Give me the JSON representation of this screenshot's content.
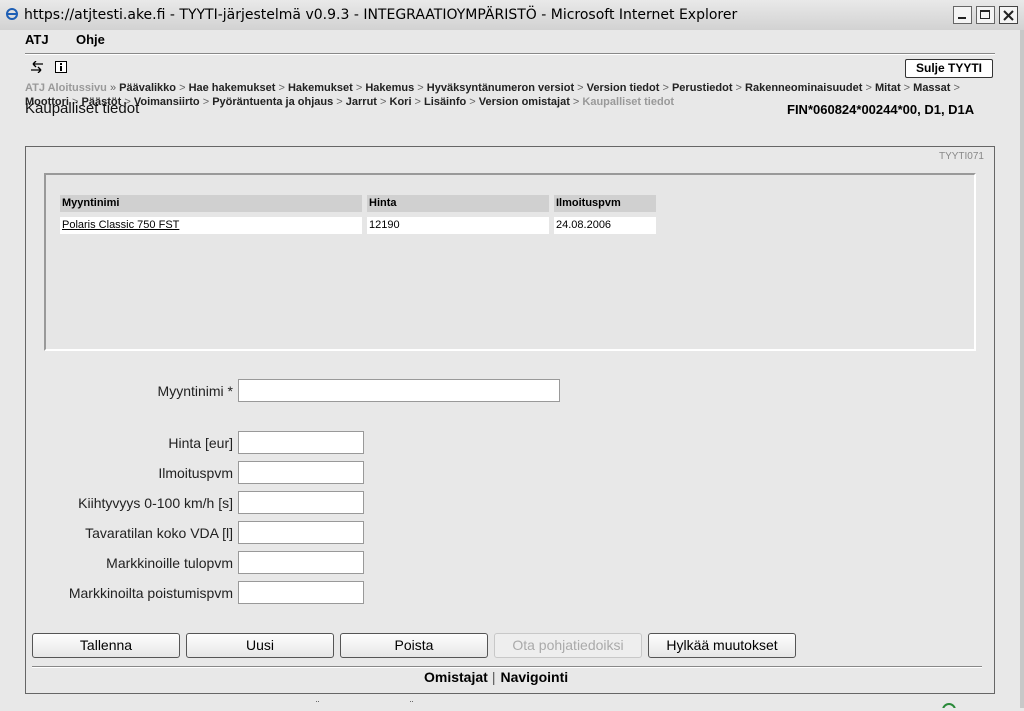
{
  "window": {
    "title": "https://atjtesti.ake.fi - TYYTI-järjestelmä v0.9.3 - INTEGRAATIOYMPÄRISTÖ - Microsoft Internet Explorer"
  },
  "menu": [
    "ATJ",
    "Ohje"
  ],
  "toolbar": {
    "close_label": "Sulje TYYTI"
  },
  "breadcrumb": {
    "items": [
      "ATJ Aloitussivu",
      "Päävalikko",
      "Hae hakemukset",
      "Hakemukset",
      "Hakemus",
      "Hyväksyntänumeron versiot",
      "Version tiedot",
      "Perustiedot",
      "Rakenneominaisuudet",
      "Mitat",
      "Massat",
      "Moottori",
      "Päästöt",
      "Voimansiirto",
      "Pyöräntuenta ja ohjaus",
      "Jarrut",
      "Kori",
      "Lisäinfo",
      "Version omistajat",
      "Kaupalliset tiedot"
    ]
  },
  "page": {
    "title": "Kaupalliset tiedot",
    "vehicle_id": "FIN*060824*00244*00, D1, D1A",
    "screen_code": "TYYTI071"
  },
  "table": {
    "columns": [
      "Myyntinimi",
      "Hinta",
      "Ilmoituspvm"
    ],
    "rows": [
      [
        "Polaris Classic 750 FST",
        "12190",
        "24.08.2006"
      ]
    ]
  },
  "form": {
    "myyntinimi_label": "Myyntinimi *",
    "hinta_label": "Hinta [eur]",
    "ilmoituspvm_label": "Ilmoituspvm",
    "kiihtyvyys_label": "Kiihtyvyys 0-100 km/h [s]",
    "tavaratila_label": "Tavaratilan koko VDA [l]",
    "tulopvm_label": "Markkinoille tulopvm",
    "poistumispvm_label": "Markkinoilta poistumispvm"
  },
  "buttons": {
    "save": "Tallenna",
    "new": "Uusi",
    "delete": "Poista",
    "base_data": "Ota pohjatiedoiksi",
    "discard": "Hylkää muutokset"
  },
  "bottom_nav": {
    "owners": "Omistajat",
    "navigation": "Navigointi"
  }
}
